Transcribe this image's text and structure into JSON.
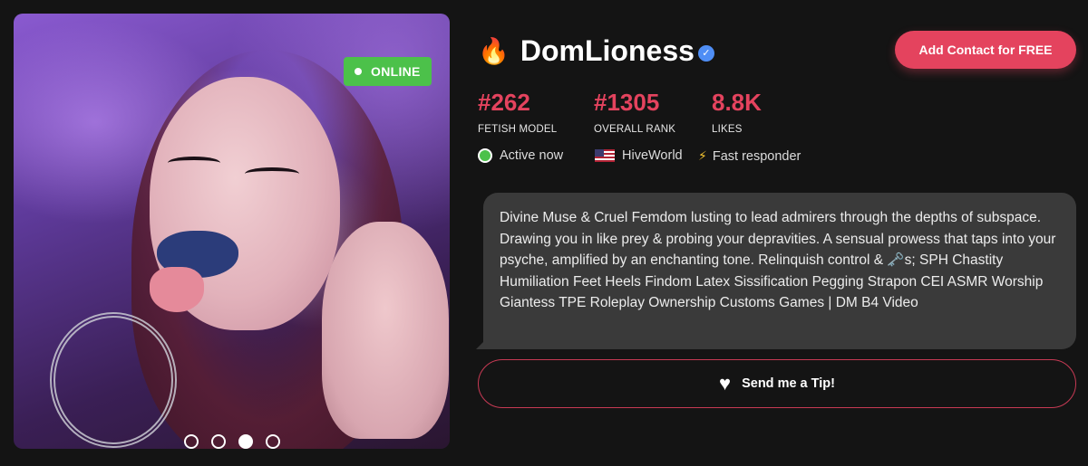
{
  "photo": {
    "badge_label": "ONLINE",
    "carousel": {
      "count": 4,
      "active_index": 2
    }
  },
  "profile": {
    "name": "DomLioness",
    "verified": true,
    "flame_icon": "fire-icon",
    "add_contact_label": "Add Contact for FREE"
  },
  "stats": [
    {
      "value": "#262",
      "label": "FETISH MODEL"
    },
    {
      "value": "#1305",
      "label": "OVERALL RANK"
    },
    {
      "value": "8.8K",
      "label": "LIKES"
    }
  ],
  "status": {
    "active": "Active now",
    "site": "HiveWorld",
    "responder": "Fast responder"
  },
  "bio": "Divine Muse & Cruel Femdom lusting to lead admirers through the depths of subspace. Drawing you in like prey & probing your depravities. A sensual prowess that taps into your psyche, amplified by an enchanting tone. Relinquish control & 🗝️s; SPH Chastity Humiliation Feet Heels Findom Latex Sissification Pegging Strapon CEI ASMR Worship Giantess TPE Roleplay Ownership Customs Games | DM B4 Video",
  "tip_label": "Send me a Tip!",
  "colors": {
    "accent": "#e4435e",
    "online": "#4cc14a",
    "background": "#141414",
    "bubble": "#3a3a3a",
    "verified": "#4f8ef5"
  }
}
